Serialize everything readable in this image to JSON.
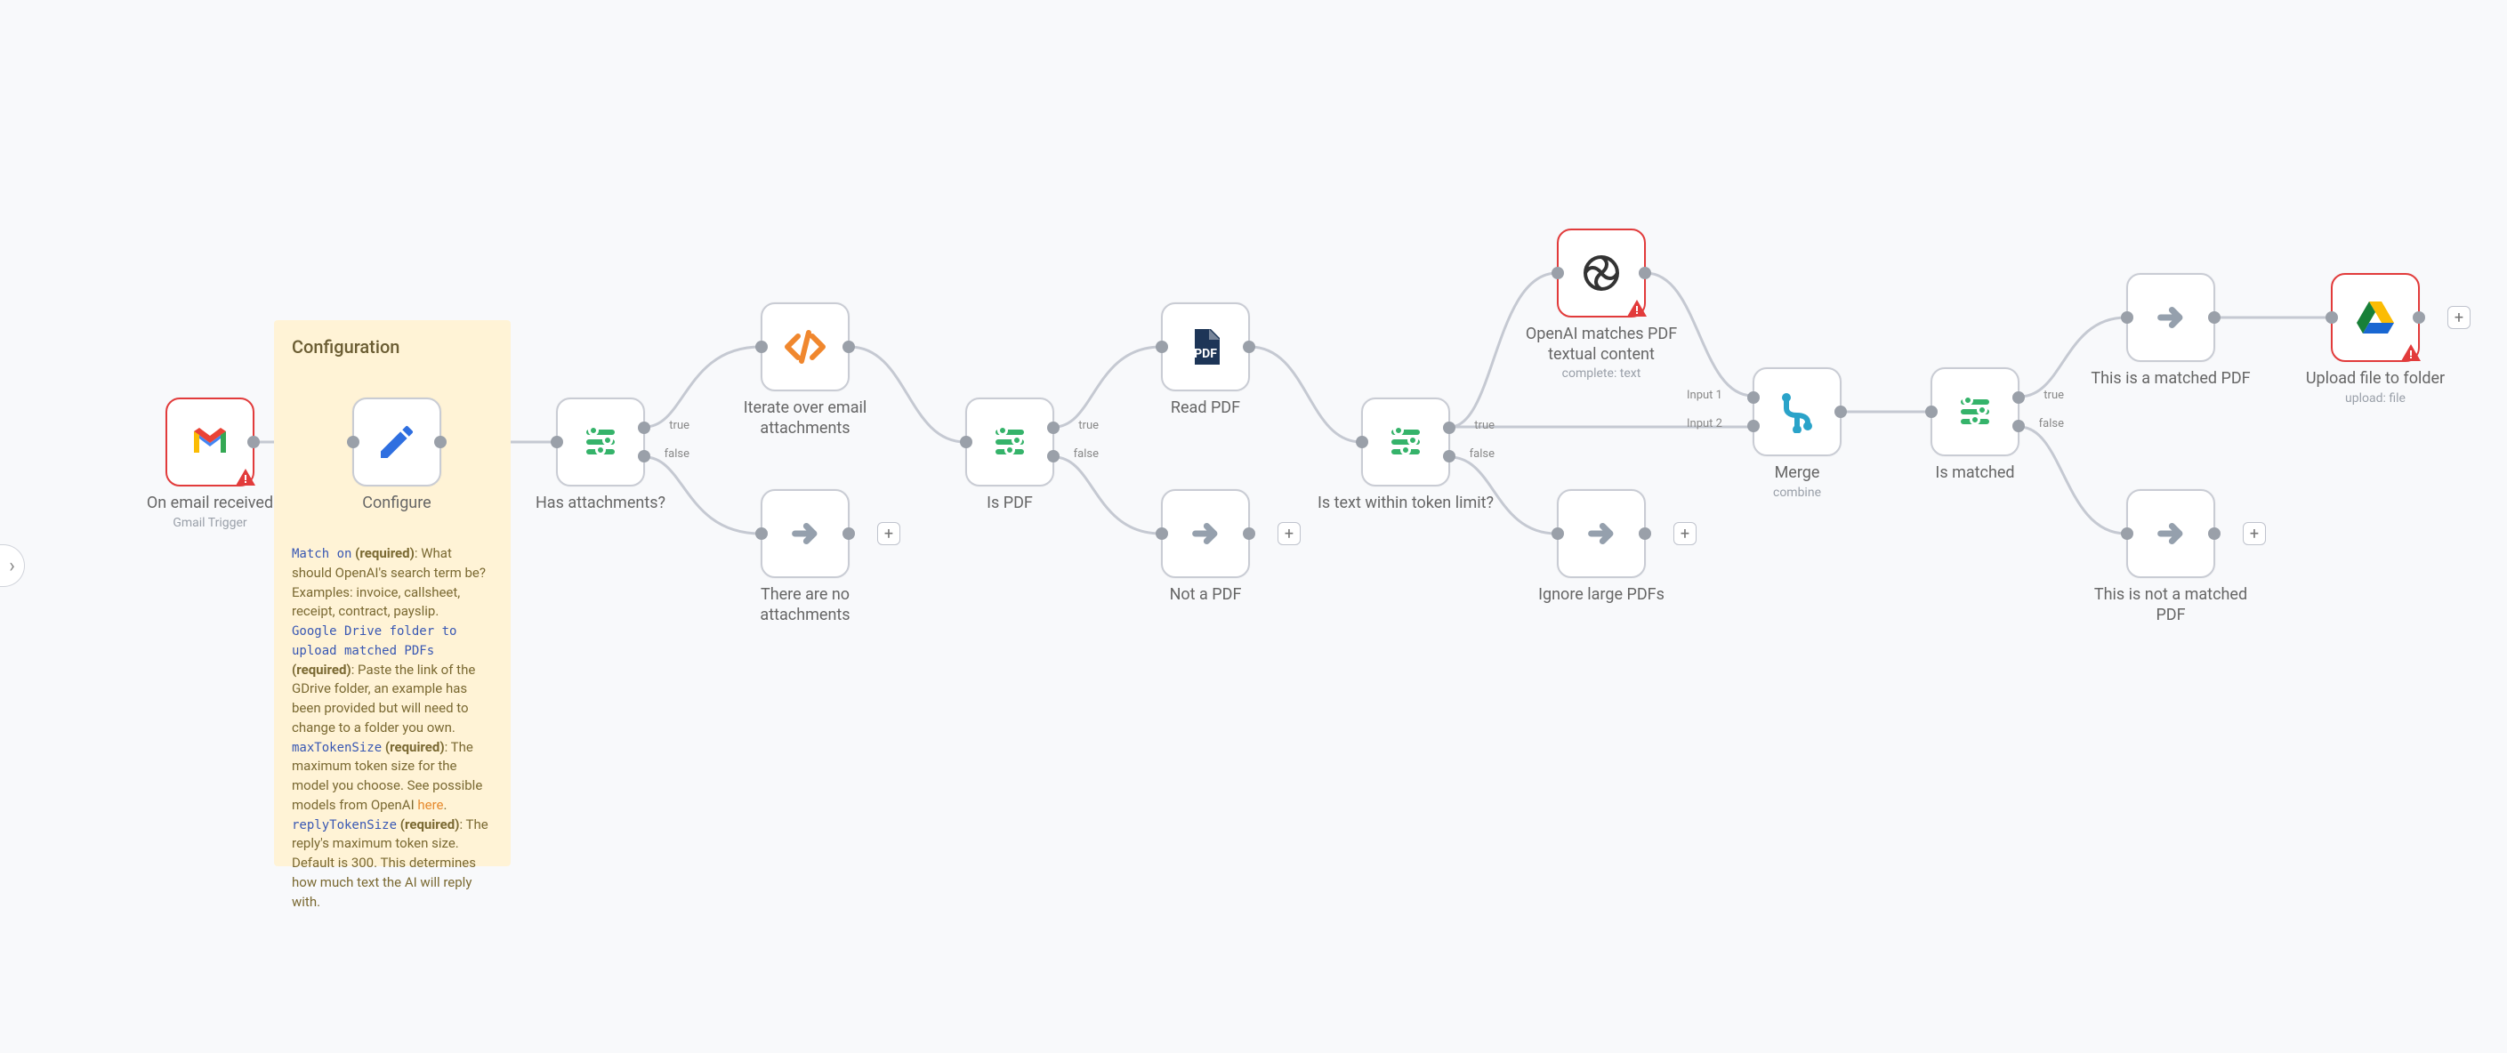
{
  "ui": {
    "edge_handle_glyph": "›"
  },
  "sticky": {
    "title": "Configuration",
    "match_on_key": "Match on",
    "match_on_req": "(required)",
    "match_on_desc": ": What should OpenAI's search term be? Examples: invoice, callsheet, receipt, contract, payslip.",
    "gdrive_key": "Google Drive folder to upload matched PDFs",
    "gdrive_req": "(required)",
    "gdrive_desc": ": Paste the link of the GDrive folder, an example has been provided but will need to change to a folder you own.",
    "maxtoken_key": "maxTokenSize",
    "maxtoken_req": "(required)",
    "maxtoken_desc": ": The maximum token size for the model you choose. See possible models from OpenAI ",
    "maxtoken_link": "here",
    "maxtoken_tail": ".",
    "replytoken_key": "replyTokenSize",
    "replytoken_req": "(required)",
    "replytoken_desc": ": The reply's maximum token size. Default is 300. This determines how much text the AI will reply with."
  },
  "nodes": {
    "trigger": {
      "title": "On email received",
      "sub": "Gmail Trigger"
    },
    "configure": {
      "title": "Configure"
    },
    "hasattach": {
      "title": "Has attachments?"
    },
    "iterate": {
      "title": "Iterate over email attachments"
    },
    "noattach": {
      "title": "There are no attachments"
    },
    "ispdf": {
      "title": "Is PDF"
    },
    "readpdf": {
      "title": "Read PDF"
    },
    "notpdf": {
      "title": "Not a PDF"
    },
    "tokenlimit": {
      "title": "Is text within token limit?"
    },
    "openai": {
      "title": "OpenAI matches PDF textual content",
      "sub": "complete: text"
    },
    "ignorelarge": {
      "title": "Ignore large PDFs"
    },
    "merge": {
      "title": "Merge",
      "sub": "combine"
    },
    "ismatched": {
      "title": "Is matched"
    },
    "matchedpdf": {
      "title": "This is a matched PDF"
    },
    "upload": {
      "title": "Upload file to folder",
      "sub": "upload: file"
    },
    "notmatched": {
      "title": "This is not a matched PDF"
    }
  },
  "labels": {
    "true": "true",
    "false": "false",
    "input1": "Input 1",
    "input2": "Input 2"
  }
}
